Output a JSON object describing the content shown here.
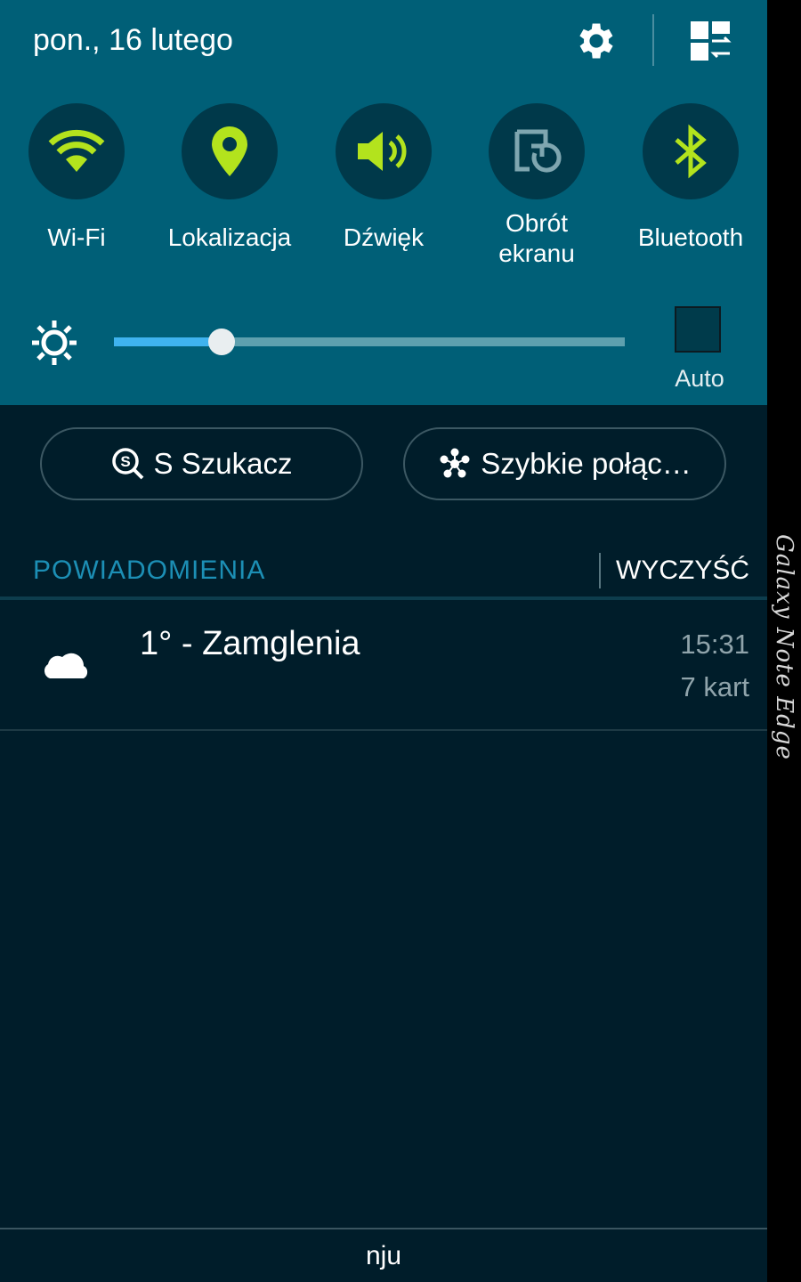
{
  "colors": {
    "quick_panel_bg": "#005f77",
    "toggle_active": "#b3e31d",
    "toggle_inactive": "#7fa6b0",
    "notification_bg": "#001d2a",
    "accent_header": "#1c8fb5",
    "slider_fill": "#3fb3ef"
  },
  "header": {
    "date": "pon., 16 lutego",
    "settings_icon": "gear-icon",
    "edit_icon": "quick-panel-edit-icon"
  },
  "toggles": [
    {
      "label": "Wi-Fi",
      "icon": "wifi-icon",
      "active": true
    },
    {
      "label": "Lokalizacja",
      "icon": "location-pin-icon",
      "active": true
    },
    {
      "label": "Dźwięk",
      "icon": "speaker-icon",
      "active": true
    },
    {
      "label_line1": "Obrót",
      "label_line2": "ekranu",
      "icon": "screen-rotation-icon",
      "active": false
    },
    {
      "label": "Bluetooth",
      "icon": "bluetooth-icon",
      "active": true
    }
  ],
  "brightness": {
    "icon": "brightness-icon",
    "level_fraction": 0.21,
    "auto_label": "Auto",
    "auto_checked": false
  },
  "buttons": {
    "s_finder": {
      "label": "S Szukacz",
      "icon": "s-finder-search-icon"
    },
    "quick_connect": {
      "label": "Szybkie połąc…",
      "icon": "quick-connect-icon"
    }
  },
  "notifications": {
    "header": "POWIADOMIENIA",
    "clear_label": "WYCZYŚĆ",
    "items": [
      {
        "icon": "cloud-icon",
        "title": "1° - Zamglenia",
        "time": "15:31",
        "subtitle": "7 kart"
      }
    ]
  },
  "carrier": "nju",
  "edge_label": "Galaxy Note Edge"
}
